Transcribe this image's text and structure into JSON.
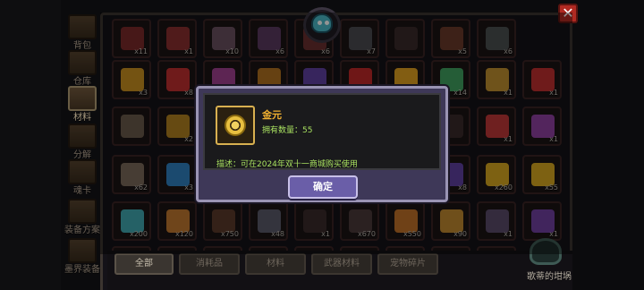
{
  "sidebar": {
    "tabs": [
      {
        "label": "背包",
        "active": false
      },
      {
        "label": "仓库",
        "active": false
      },
      {
        "label": "材料",
        "active": true
      },
      {
        "label": "分解",
        "active": false
      },
      {
        "label": "魂卡",
        "active": false
      },
      {
        "label": "装备方案",
        "active": false
      },
      {
        "label": "墨界装备",
        "active": false
      }
    ]
  },
  "grid": {
    "rows": [
      [
        {
          "count": "x11",
          "color": "#7a2a2a"
        },
        {
          "count": "x1",
          "color": "#8a3030"
        },
        {
          "count": "x10",
          "color": "#6a5060"
        },
        {
          "count": "x6",
          "color": "#5a3a60"
        },
        {
          "count": "x6",
          "color": "#6a3030"
        },
        {
          "count": "x7",
          "color": "#4a4a50"
        },
        {
          "count": "",
          "color": "#3a2a2a"
        },
        {
          "count": "x5",
          "color": "#6a3a2a"
        },
        {
          "count": "x6",
          "color": "#4a5050"
        }
      ],
      [
        {
          "count": "x3",
          "color": "#c89020"
        },
        {
          "count": "x8",
          "color": "#c03030"
        },
        {
          "count": "x5",
          "color": "#a04090"
        },
        {
          "count": "x21",
          "color": "#b07020"
        },
        {
          "count": "x2",
          "color": "#6040a0"
        },
        {
          "count": "x17",
          "color": "#c02828"
        },
        {
          "count": "x483",
          "color": "#e0a020"
        },
        {
          "count": "x14",
          "color": "#40a060"
        },
        {
          "count": "x1",
          "color": "#c09030"
        },
        {
          "count": "x1",
          "color": "#c03030"
        }
      ],
      [
        {
          "count": "",
          "color": "#6a5a4a"
        },
        {
          "count": "x2",
          "color": "#b08020"
        },
        {
          "count": "",
          "color": "#d8d8d8"
        },
        {
          "count": "",
          "color": "#3a2a2a"
        },
        {
          "count": "",
          "color": "#3a2a2a"
        },
        {
          "count": "",
          "color": "#3a2a2a"
        },
        {
          "count": "",
          "color": "#3a2a2a"
        },
        {
          "count": "",
          "color": "#3a2a2a"
        },
        {
          "count": "x1",
          "color": "#c03838"
        },
        {
          "count": "x1",
          "color": "#9040a0"
        }
      ],
      [
        {
          "count": "x62",
          "color": "#7a6a5a"
        },
        {
          "count": "x3",
          "color": "#3080c0"
        },
        {
          "count": "",
          "color": "#3a2a2a"
        },
        {
          "count": "",
          "color": "#3a2a2a"
        },
        {
          "count": "",
          "color": "#3a2a2a"
        },
        {
          "count": "",
          "color": "#3a2a2a"
        },
        {
          "count": "",
          "color": "#3a2a2a"
        },
        {
          "count": "x8",
          "color": "#6040a0"
        },
        {
          "count": "x260",
          "color": "#d8a820"
        },
        {
          "count": "x55",
          "color": "#d8a820"
        }
      ],
      [
        {
          "count": "x200",
          "color": "#40a8b0"
        },
        {
          "count": "x120",
          "color": "#c07830"
        },
        {
          "count": "x750",
          "color": "#5a3a2a"
        },
        {
          "count": "x48",
          "color": "#5a5a6a"
        },
        {
          "count": "x1",
          "color": "#3a2a2a"
        },
        {
          "count": "x670",
          "color": "#4a3a3a"
        },
        {
          "count": "x550",
          "color": "#c07028"
        },
        {
          "count": "x90",
          "color": "#c08830"
        },
        {
          "count": "x1",
          "color": "#5a4a6a"
        },
        {
          "count": "x1",
          "color": "#7040a0"
        }
      ],
      [
        {
          "count": "",
          "color": "#5a3a6a"
        },
        {
          "count": "",
          "color": "#8a5a3a"
        },
        {
          "count": "",
          "color": "#6a5a4a"
        },
        {
          "count": "",
          "color": "#6a6a7a"
        },
        {
          "count": "",
          "color": "#6a4a6a"
        },
        {
          "count": "",
          "color": "#5a3a7a"
        },
        {
          "count": "",
          "color": "#c05030"
        },
        {
          "count": "",
          "color": "#4a4a5a"
        },
        {
          "count": "",
          "color": "#d8a820"
        }
      ]
    ]
  },
  "filters": [
    {
      "label": "全部",
      "active": true
    },
    {
      "label": "消耗品",
      "active": false
    },
    {
      "label": "材料",
      "active": false
    },
    {
      "label": "武器材料",
      "active": false
    },
    {
      "label": "宠物碎片",
      "active": false
    }
  ],
  "close_button": {
    "label": "✕"
  },
  "corner": {
    "label": "歌蒂的坩埚"
  },
  "dialog": {
    "item_name": "金元",
    "quantity_text": "拥有数量：55",
    "description": "描述：可在2024年双十一商城购买使用",
    "confirm_label": "确定"
  },
  "colors": {
    "dialog_bg": "#3e3858",
    "dialog_border": "#9a94b4",
    "item_name": "#f0b030",
    "info_text": "#a8e060",
    "confirm_button": "#6a5ea8",
    "close_button": "#b02a22"
  }
}
